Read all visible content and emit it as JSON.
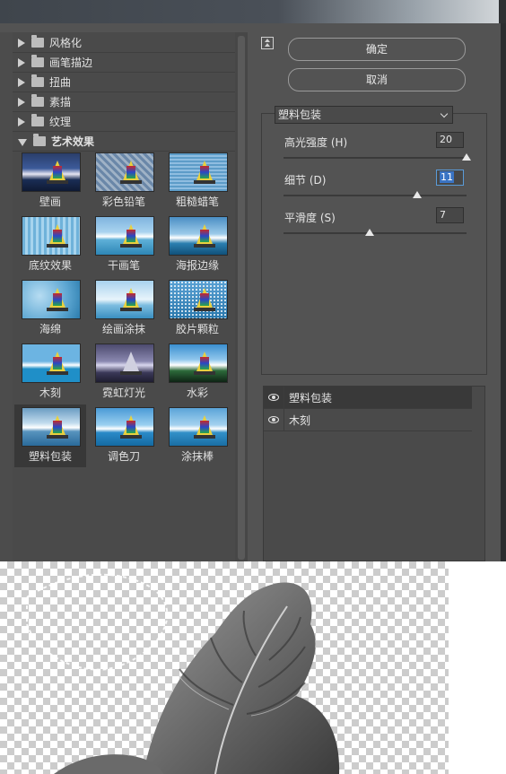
{
  "gallery": {
    "folders": [
      {
        "label": "风格化",
        "open": false
      },
      {
        "label": "画笔描边",
        "open": false
      },
      {
        "label": "扭曲",
        "open": false
      },
      {
        "label": "素描",
        "open": false
      },
      {
        "label": "纹理",
        "open": false
      },
      {
        "label": "艺术效果",
        "open": true
      }
    ],
    "thumbnails": [
      "壁画",
      "彩色铅笔",
      "粗糙蜡笔",
      "底纹效果",
      "干画笔",
      "海报边缘",
      "海绵",
      "绘画涂抹",
      "胶片颗粒",
      "木刻",
      "霓虹灯光",
      "水彩",
      "塑料包装",
      "调色刀",
      "涂抹棒"
    ],
    "selected_thumbnail": "塑料包装"
  },
  "buttons": {
    "ok": "确定",
    "cancel": "取消"
  },
  "filter_select": {
    "value": "塑料包装"
  },
  "params": [
    {
      "label": "高光强度 (H)",
      "value": "20",
      "level": 1.0
    },
    {
      "label": "细节 (D)",
      "value": "11",
      "level": 0.73
    },
    {
      "label": "平滑度 (S)",
      "value": "7",
      "level": 0.47
    }
  ],
  "effect_layers": [
    {
      "label": "塑料包装",
      "active": true
    },
    {
      "label": "木刻",
      "active": false
    }
  ],
  "colors": {
    "panel": "#535353",
    "accent_selection": "#3a74c4"
  }
}
